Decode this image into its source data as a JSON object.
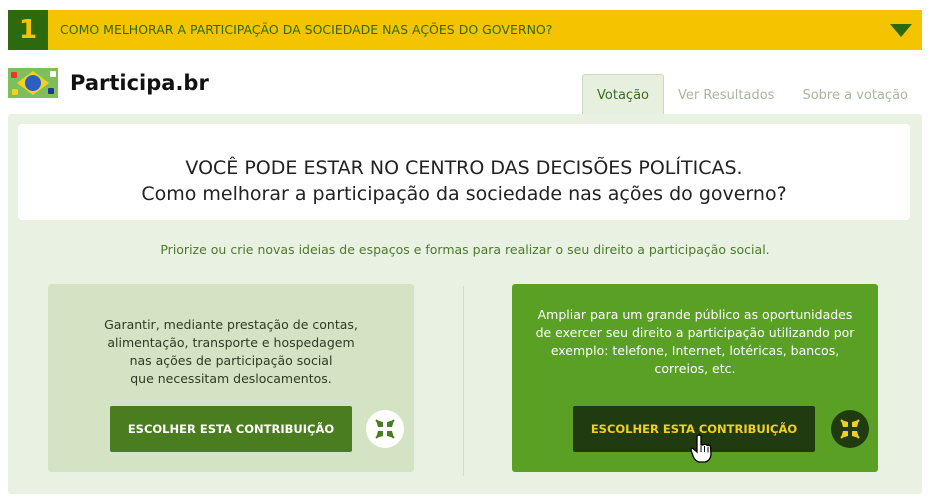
{
  "header": {
    "number": "1",
    "question": "COMO MELHORAR A PARTICIPAÇÃO DA SOCIEDADE NAS AÇÕES DO GOVERNO?",
    "toggle_icon": "triangle-down-icon"
  },
  "brand": {
    "name": "Participa.br",
    "logo_icon": "brazil-flag-logo-icon"
  },
  "tabs": [
    {
      "label": "Votação",
      "active": true
    },
    {
      "label": "Ver Resultados",
      "active": false
    },
    {
      "label": "Sobre a votação",
      "active": false
    }
  ],
  "hero": {
    "line1": "VOCÊ PODE ESTAR NO CENTRO DAS DECISÕES POLÍTICAS.",
    "line2": "Como melhorar a participação da sociedade nas ações do governo?"
  },
  "instruction": "Priorize ou crie novas ideias de espaços e formas para realizar o seu direito a participação social.",
  "options": [
    {
      "lines": [
        "Garantir, mediante prestação de contas,",
        "alimentação, transporte e hospedagem",
        "nas ações de participação social",
        "que necessitam deslocamentos."
      ],
      "button": "ESCOLHER ESTA CONTRIBUIÇÃO",
      "icon": "shrink-arrows-icon",
      "highlighted": false
    },
    {
      "lines": [
        "Ampliar para um grande público as oportunidades",
        "de exercer seu direito a participação utilizando por",
        "exemplo: telefone, Internet, lotéricas, bancos,",
        "correios, etc."
      ],
      "button": "ESCOLHER ESTA CONTRIBUIÇÃO",
      "icon": "shrink-arrows-icon",
      "highlighted": true
    }
  ],
  "colors": {
    "yellow": "#f5c400",
    "dark_green": "#2d6a0e",
    "panel_bg": "#e9f1e2",
    "card_left": "#d3e3c4",
    "card_right": "#5aa024"
  },
  "cursor_icon": "hand-pointer-icon"
}
